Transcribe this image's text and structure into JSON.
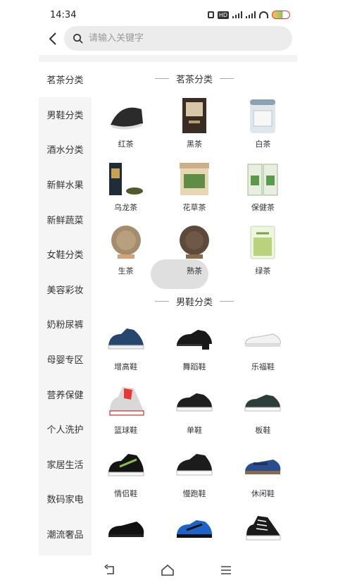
{
  "status": {
    "time": "14:34"
  },
  "search": {
    "placeholder": "请输入关键字"
  },
  "sidebar": {
    "items": [
      {
        "label": "茗茶分类",
        "active": true
      },
      {
        "label": "男鞋分类"
      },
      {
        "label": "酒水分类"
      },
      {
        "label": "新鲜水果"
      },
      {
        "label": "新鲜蔬菜"
      },
      {
        "label": "女鞋分类"
      },
      {
        "label": "美容彩妆"
      },
      {
        "label": "奶粉尿裤"
      },
      {
        "label": "母婴专区"
      },
      {
        "label": "营养保健"
      },
      {
        "label": "个人洗护"
      },
      {
        "label": "家居生活"
      },
      {
        "label": "数码家电"
      },
      {
        "label": "潮流奢品"
      }
    ]
  },
  "sections": [
    {
      "title": "茗茶分类",
      "items": [
        {
          "label": "红茶",
          "icon": "black-tea-cake-icon"
        },
        {
          "label": "黑茶",
          "icon": "dark-tea-box-icon"
        },
        {
          "label": "白茶",
          "icon": "white-tea-tin-icon"
        },
        {
          "label": "乌龙茶",
          "icon": "oolong-tea-package-icon"
        },
        {
          "label": "花草茶",
          "icon": "herbal-tea-jar-icon"
        },
        {
          "label": "保健茶",
          "icon": "health-tea-bags-icon"
        },
        {
          "label": "生茶",
          "icon": "raw-puer-cake-icon"
        },
        {
          "label": "熟茶",
          "icon": "ripe-puer-cake-icon"
        },
        {
          "label": "绿茶",
          "icon": "green-tea-glass-icon"
        }
      ]
    },
    {
      "title": "男鞋分类",
      "items": [
        {
          "label": "增高鞋",
          "icon": "elevator-shoe-icon"
        },
        {
          "label": "舞蹈鞋",
          "icon": "dance-shoe-icon"
        },
        {
          "label": "乐福鞋",
          "icon": "loafer-shoe-icon"
        },
        {
          "label": "篮球鞋",
          "icon": "basketball-shoe-icon"
        },
        {
          "label": "单鞋",
          "icon": "casual-shoe-icon"
        },
        {
          "label": "板鞋",
          "icon": "skate-shoe-icon"
        },
        {
          "label": "情侣鞋",
          "icon": "couple-shoe-icon"
        },
        {
          "label": "慢跑鞋",
          "icon": "jogging-shoe-icon"
        },
        {
          "label": "休闲鞋",
          "icon": "leisure-shoe-icon"
        },
        {
          "label": "",
          "icon": "formal-shoe-icon"
        },
        {
          "label": "",
          "icon": "running-shoe-icon"
        },
        {
          "label": "",
          "icon": "canvas-shoe-icon"
        }
      ]
    }
  ],
  "colors": {
    "accent": "#333333",
    "sidebar_bg": "#f5f5f5",
    "search_bg": "#ececec"
  }
}
